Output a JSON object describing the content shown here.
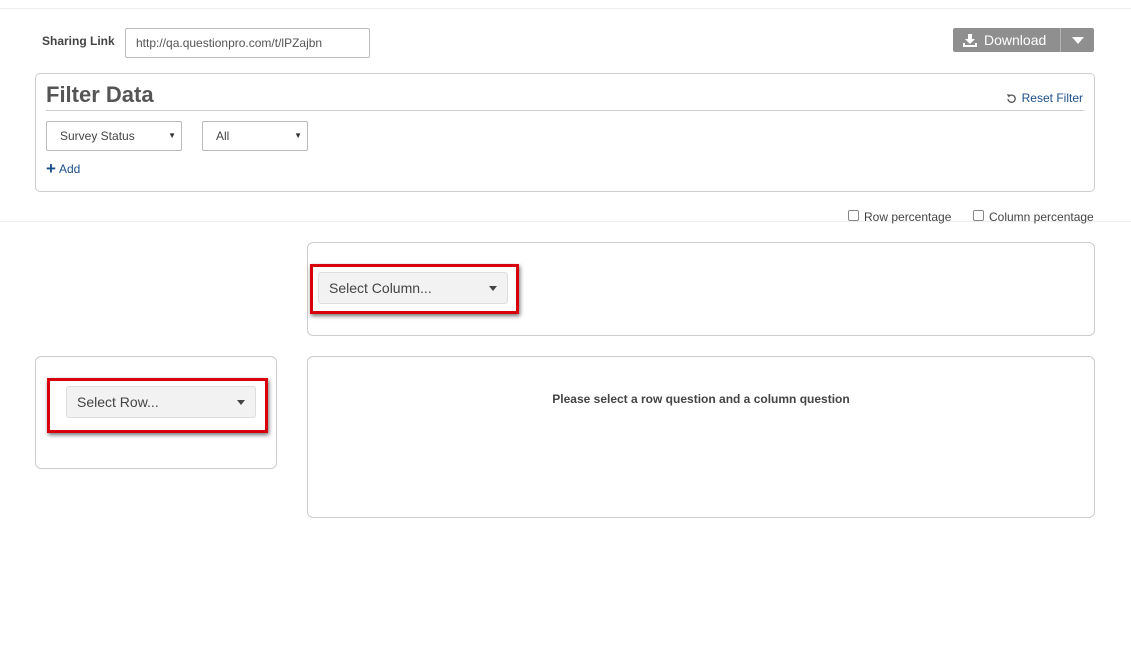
{
  "sharing": {
    "label": "Sharing Link",
    "url": "http://qa.questionpro.com/t/lPZajbn"
  },
  "download": {
    "label": "Download",
    "icon": "download-icon",
    "button_color": "#8f8f8f"
  },
  "filter": {
    "title": "Filter Data",
    "reset_label": "Reset Filter",
    "field_select": "Survey Status",
    "value_select": "All",
    "add_label": "Add",
    "link_color": "#1c4f8a"
  },
  "options": {
    "row_percentage": "Row percentage",
    "column_percentage": "Column percentage"
  },
  "crosstab": {
    "column_placeholder": "Select Column...",
    "row_placeholder": "Select Row...",
    "empty_message": "Please select a row question and a column question",
    "highlight_color": "#d9000d"
  }
}
